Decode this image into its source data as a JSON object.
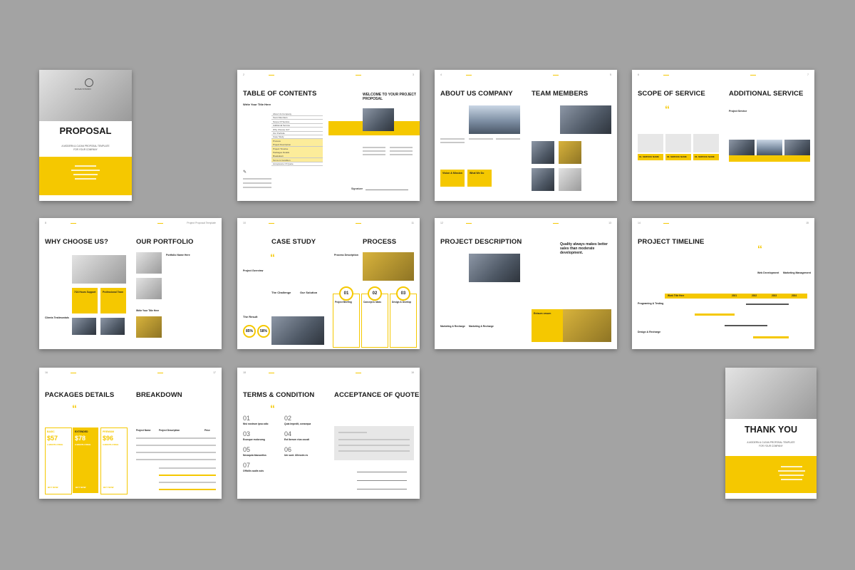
{
  "colors": {
    "accent": "#f5c800",
    "background": "#a3a3a3",
    "paper": "#ffffff"
  },
  "header_title": "Project Proposal Template",
  "cover": {
    "title": "PROPOSAL",
    "subtitle": "A MODERN & CLEAN PROPOSAL TEMPLATE",
    "subtitle2": "FOR YOUR COMPANY",
    "logo": "DUSAN STUDIO"
  },
  "p2": {
    "num_l": "2",
    "num_r": "3",
    "title": "TABLE OF CONTENTS",
    "write_title": "Write Your Title Here",
    "toc": [
      "About Us Company",
      "Team Members",
      "Scope Of Service",
      "Additional Service",
      "Why Choose Us?",
      "Our Portfolio",
      "Case Study",
      "Process",
      "Project Description",
      "Project Timeline",
      "Packages Details",
      "Breakdown",
      "Terms & Condition",
      "Acceptance Of Quote"
    ],
    "welcome": "WELCOME TO YOUR PROJECT PROPOSAL",
    "signature": "Signature"
  },
  "p3": {
    "num_l": "4",
    "num_r": "5",
    "title_l": "ABOUT US COMPANY",
    "title_r": "TEAM MEMBERS",
    "vision": "Vision & Mission",
    "what": "What We Do"
  },
  "p4": {
    "num_l": "6",
    "num_r": "7",
    "title_l": "SCOPE OF SERVICE",
    "title_r": "ADDITIONAL SERVICE",
    "project_service": "Project Service",
    "service_names": [
      "01. SERVICE NAME",
      "02. SERVICE NAME",
      "03. SERVICE NAME"
    ]
  },
  "p5": {
    "num_l": "8",
    "num_r": "9",
    "title_l": "WHY CHOOSE US?",
    "title_r": "OUR PORTFOLIO",
    "support": "7/24 Hours Support",
    "team": "Professional Team",
    "testimonial": "Clients Testimonials",
    "portfolio_name": "Portfolio Name Here",
    "write_title": "Write Your Title Here"
  },
  "p6": {
    "num_l": "10",
    "num_r": "11",
    "title_l": "CASE STUDY",
    "title_r": "PROCESS",
    "overview": "Project Overview",
    "challenge": "The Challenge",
    "solution": "Our Solution",
    "result": "The Result",
    "pct1": "85%",
    "pct2": "58%",
    "process_desc": "Process Description",
    "steps": [
      {
        "n": "01",
        "t": "Project Briefing"
      },
      {
        "n": "02",
        "t": "Concept & Ideas"
      },
      {
        "n": "03",
        "t": "Design & Develop"
      }
    ]
  },
  "p7": {
    "num_l": "12",
    "num_r": "13",
    "title_l": "PROJECT DESCRIPTION",
    "quote_r": "Quality always makes better sales than moderate development.",
    "mk1": "Marketing & Recharge",
    "mk2": "Marketing & Recharge",
    "lorem": "Enisum orsum"
  },
  "p8": {
    "num_l": "14",
    "num_r": "15",
    "title": "PROJECT TIMELINE",
    "web_dev": "Web Development",
    "marketing": "Marketing Management",
    "prog": "Programing & Testing",
    "design": "Design & Recharge",
    "table_head": [
      "Work Title Here",
      "2021",
      "2022",
      "2023",
      "2024"
    ]
  },
  "p9": {
    "num_l": "16",
    "num_r": "17",
    "title_l": "PACKAGES DETAILS",
    "title_r": "BREAKDOWN",
    "packages": [
      {
        "name": "BASIC",
        "price": "$57",
        "term": "1 MONTH FREE",
        "btn": "BUY NOW"
      },
      {
        "name": "EXTENDED",
        "price": "$78",
        "term": "2 MONTH FREE",
        "btn": "BUY NOW"
      },
      {
        "name": "PREMIUM",
        "price": "$96",
        "term": "3 MONTH FREE",
        "btn": "BUY NOW"
      }
    ],
    "table_head": [
      "Project Name",
      "Project Description",
      "Price"
    ]
  },
  "p10": {
    "num_l": "18",
    "num_r": "19",
    "title_l": "TERMS & CONDITION",
    "title_r": "ACCEPTANCE OF QUOTE",
    "terms": [
      {
        "n": "01",
        "t": "Nisi nostrum ipsa odio"
      },
      {
        "n": "02",
        "t": "Quia impedit, consequa"
      },
      {
        "n": "03",
        "t": "Ecusque molorumg"
      },
      {
        "n": "04",
        "t": "Est Iberum eius ocusti"
      },
      {
        "n": "05",
        "t": "Necaquia tiassuntiss"
      },
      {
        "n": "06",
        "t": "Um sunt. Ullessim es"
      },
      {
        "n": "07",
        "t": "Officilis audis sois"
      }
    ]
  },
  "back": {
    "title": "THANK YOU",
    "subtitle": "A MODERN & CLEAN PROPOSAL TEMPLATE",
    "subtitle2": "FOR YOUR COMPANY",
    "logo": "DUSAN STUDIO"
  }
}
